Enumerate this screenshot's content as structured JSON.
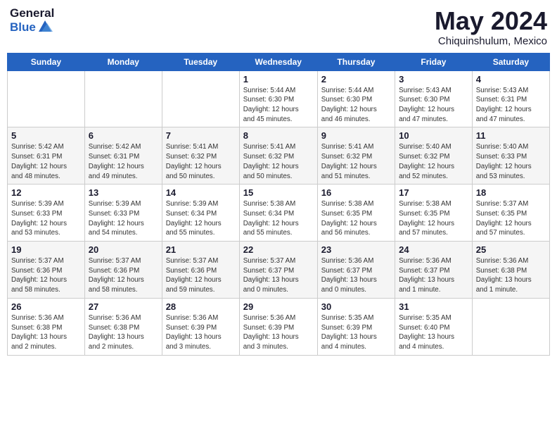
{
  "header": {
    "logo_general": "General",
    "logo_blue": "Blue",
    "month": "May 2024",
    "location": "Chiquinshulum, Mexico"
  },
  "weekdays": [
    "Sunday",
    "Monday",
    "Tuesday",
    "Wednesday",
    "Thursday",
    "Friday",
    "Saturday"
  ],
  "weeks": [
    [
      {
        "date": "",
        "info": ""
      },
      {
        "date": "",
        "info": ""
      },
      {
        "date": "",
        "info": ""
      },
      {
        "date": "1",
        "info": "Sunrise: 5:44 AM\nSunset: 6:30 PM\nDaylight: 12 hours\nand 45 minutes."
      },
      {
        "date": "2",
        "info": "Sunrise: 5:44 AM\nSunset: 6:30 PM\nDaylight: 12 hours\nand 46 minutes."
      },
      {
        "date": "3",
        "info": "Sunrise: 5:43 AM\nSunset: 6:30 PM\nDaylight: 12 hours\nand 47 minutes."
      },
      {
        "date": "4",
        "info": "Sunrise: 5:43 AM\nSunset: 6:31 PM\nDaylight: 12 hours\nand 47 minutes."
      }
    ],
    [
      {
        "date": "5",
        "info": "Sunrise: 5:42 AM\nSunset: 6:31 PM\nDaylight: 12 hours\nand 48 minutes."
      },
      {
        "date": "6",
        "info": "Sunrise: 5:42 AM\nSunset: 6:31 PM\nDaylight: 12 hours\nand 49 minutes."
      },
      {
        "date": "7",
        "info": "Sunrise: 5:41 AM\nSunset: 6:32 PM\nDaylight: 12 hours\nand 50 minutes."
      },
      {
        "date": "8",
        "info": "Sunrise: 5:41 AM\nSunset: 6:32 PM\nDaylight: 12 hours\nand 50 minutes."
      },
      {
        "date": "9",
        "info": "Sunrise: 5:41 AM\nSunset: 6:32 PM\nDaylight: 12 hours\nand 51 minutes."
      },
      {
        "date": "10",
        "info": "Sunrise: 5:40 AM\nSunset: 6:32 PM\nDaylight: 12 hours\nand 52 minutes."
      },
      {
        "date": "11",
        "info": "Sunrise: 5:40 AM\nSunset: 6:33 PM\nDaylight: 12 hours\nand 53 minutes."
      }
    ],
    [
      {
        "date": "12",
        "info": "Sunrise: 5:39 AM\nSunset: 6:33 PM\nDaylight: 12 hours\nand 53 minutes."
      },
      {
        "date": "13",
        "info": "Sunrise: 5:39 AM\nSunset: 6:33 PM\nDaylight: 12 hours\nand 54 minutes."
      },
      {
        "date": "14",
        "info": "Sunrise: 5:39 AM\nSunset: 6:34 PM\nDaylight: 12 hours\nand 55 minutes."
      },
      {
        "date": "15",
        "info": "Sunrise: 5:38 AM\nSunset: 6:34 PM\nDaylight: 12 hours\nand 55 minutes."
      },
      {
        "date": "16",
        "info": "Sunrise: 5:38 AM\nSunset: 6:35 PM\nDaylight: 12 hours\nand 56 minutes."
      },
      {
        "date": "17",
        "info": "Sunrise: 5:38 AM\nSunset: 6:35 PM\nDaylight: 12 hours\nand 57 minutes."
      },
      {
        "date": "18",
        "info": "Sunrise: 5:37 AM\nSunset: 6:35 PM\nDaylight: 12 hours\nand 57 minutes."
      }
    ],
    [
      {
        "date": "19",
        "info": "Sunrise: 5:37 AM\nSunset: 6:36 PM\nDaylight: 12 hours\nand 58 minutes."
      },
      {
        "date": "20",
        "info": "Sunrise: 5:37 AM\nSunset: 6:36 PM\nDaylight: 12 hours\nand 58 minutes."
      },
      {
        "date": "21",
        "info": "Sunrise: 5:37 AM\nSunset: 6:36 PM\nDaylight: 12 hours\nand 59 minutes."
      },
      {
        "date": "22",
        "info": "Sunrise: 5:37 AM\nSunset: 6:37 PM\nDaylight: 13 hours\nand 0 minutes."
      },
      {
        "date": "23",
        "info": "Sunrise: 5:36 AM\nSunset: 6:37 PM\nDaylight: 13 hours\nand 0 minutes."
      },
      {
        "date": "24",
        "info": "Sunrise: 5:36 AM\nSunset: 6:37 PM\nDaylight: 13 hours\nand 1 minute."
      },
      {
        "date": "25",
        "info": "Sunrise: 5:36 AM\nSunset: 6:38 PM\nDaylight: 13 hours\nand 1 minute."
      }
    ],
    [
      {
        "date": "26",
        "info": "Sunrise: 5:36 AM\nSunset: 6:38 PM\nDaylight: 13 hours\nand 2 minutes."
      },
      {
        "date": "27",
        "info": "Sunrise: 5:36 AM\nSunset: 6:38 PM\nDaylight: 13 hours\nand 2 minutes."
      },
      {
        "date": "28",
        "info": "Sunrise: 5:36 AM\nSunset: 6:39 PM\nDaylight: 13 hours\nand 3 minutes."
      },
      {
        "date": "29",
        "info": "Sunrise: 5:36 AM\nSunset: 6:39 PM\nDaylight: 13 hours\nand 3 minutes."
      },
      {
        "date": "30",
        "info": "Sunrise: 5:35 AM\nSunset: 6:39 PM\nDaylight: 13 hours\nand 4 minutes."
      },
      {
        "date": "31",
        "info": "Sunrise: 5:35 AM\nSunset: 6:40 PM\nDaylight: 13 hours\nand 4 minutes."
      },
      {
        "date": "",
        "info": ""
      }
    ]
  ]
}
